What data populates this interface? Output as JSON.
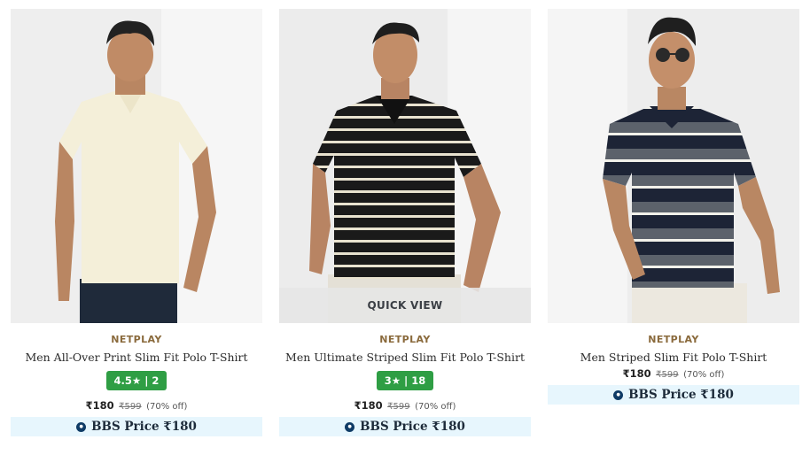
{
  "products": [
    {
      "brand": "NETPLAY",
      "name": "Men All-Over Print Slim Fit Polo T-Shirt",
      "rating": "4.5★ | 2",
      "price": "₹180",
      "mrp": "₹599",
      "discount": "(70% off)",
      "bbs_label": "BBS Price ₹180"
    },
    {
      "brand": "NETPLAY",
      "name": "Men Ultimate Striped Slim Fit Polo T-Shirt",
      "rating": "3★ | 18",
      "price": "₹180",
      "mrp": "₹599",
      "discount": "(70% off)",
      "bbs_label": "BBS Price ₹180",
      "quick_view": "QUICK VIEW"
    },
    {
      "brand": "NETPLAY",
      "name": "Men Striped Slim Fit Polo T-Shirt",
      "price": "₹180",
      "mrp": "₹599",
      "discount": "(70% off)",
      "bbs_label": "BBS Price ₹180"
    }
  ],
  "colors": {
    "brand_text": "#8a6a3c",
    "rating_badge": "#2f9e44",
    "bbs_bg": "#e7f6fd",
    "bbs_logo": "#0f3b66"
  },
  "icons": [
    "bbs-logo-icon",
    "star-icon"
  ]
}
